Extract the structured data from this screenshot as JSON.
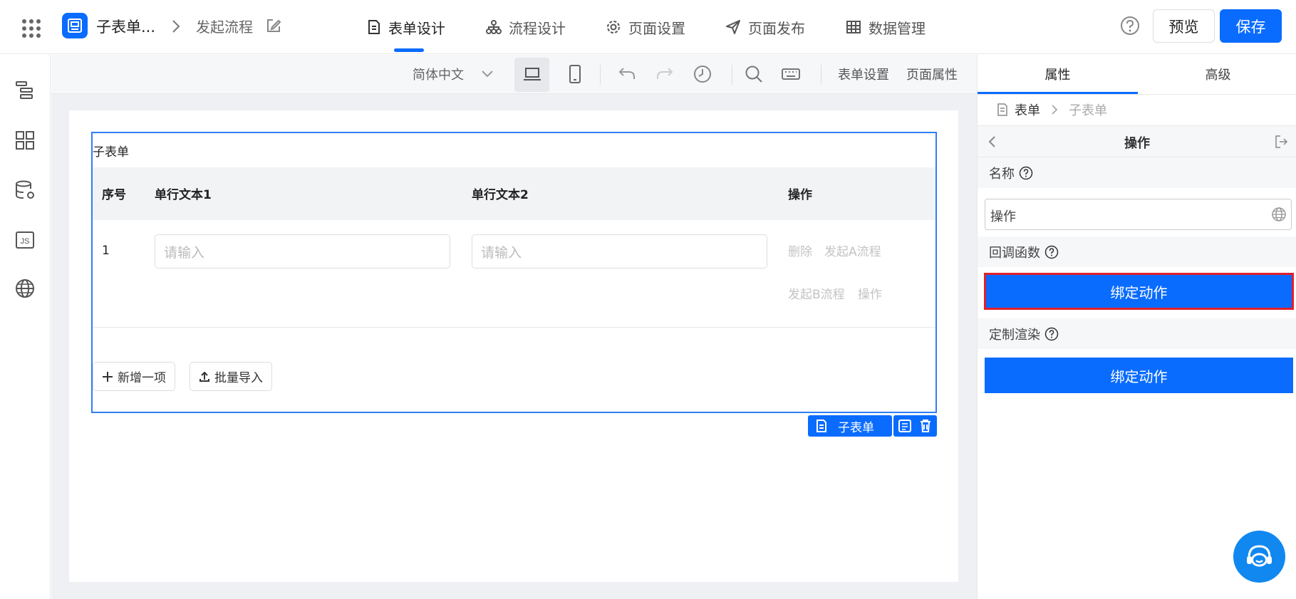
{
  "header": {
    "app_name": "子表单...",
    "flow_name": "发起流程",
    "nav": [
      {
        "label": "表单设计",
        "icon": "document-icon",
        "active": true
      },
      {
        "label": "流程设计",
        "icon": "flow-icon",
        "active": false
      },
      {
        "label": "页面设置",
        "icon": "gear-icon",
        "active": false
      },
      {
        "label": "页面发布",
        "icon": "send-icon",
        "active": false
      },
      {
        "label": "数据管理",
        "icon": "table-icon",
        "active": false
      }
    ],
    "preview_label": "预览",
    "save_label": "保存"
  },
  "sidebar": {
    "icons": [
      "outline-icon",
      "components-icon",
      "datasource-icon",
      "js-icon",
      "globe-icon"
    ]
  },
  "toolbar": {
    "language": "简体中文",
    "form_settings": "表单设置",
    "page_props": "页面属性"
  },
  "subform": {
    "title": "子表单",
    "columns": [
      "序号",
      "单行文本1",
      "单行文本2",
      "操作"
    ],
    "rows": [
      {
        "index": "1",
        "placeholder1": "请输入",
        "placeholder2": "请输入",
        "actions": [
          "删除",
          "发起A流程",
          "发起B流程",
          "操作"
        ]
      }
    ],
    "add_label": "新增一项",
    "import_label": "批量导入",
    "tag_label": "子表单"
  },
  "panel": {
    "tabs": [
      "属性",
      "高级"
    ],
    "crumb_root": "表单",
    "crumb_current": "子表单",
    "header_title": "操作",
    "name_label": "名称",
    "name_value": "操作",
    "callback_label": "回调函数",
    "bind_label": "绑定动作",
    "render_label": "定制渲染",
    "bind_label_2": "绑定动作"
  },
  "colors": {
    "accent": "#0a6cff",
    "highlight": "#e0202a"
  }
}
